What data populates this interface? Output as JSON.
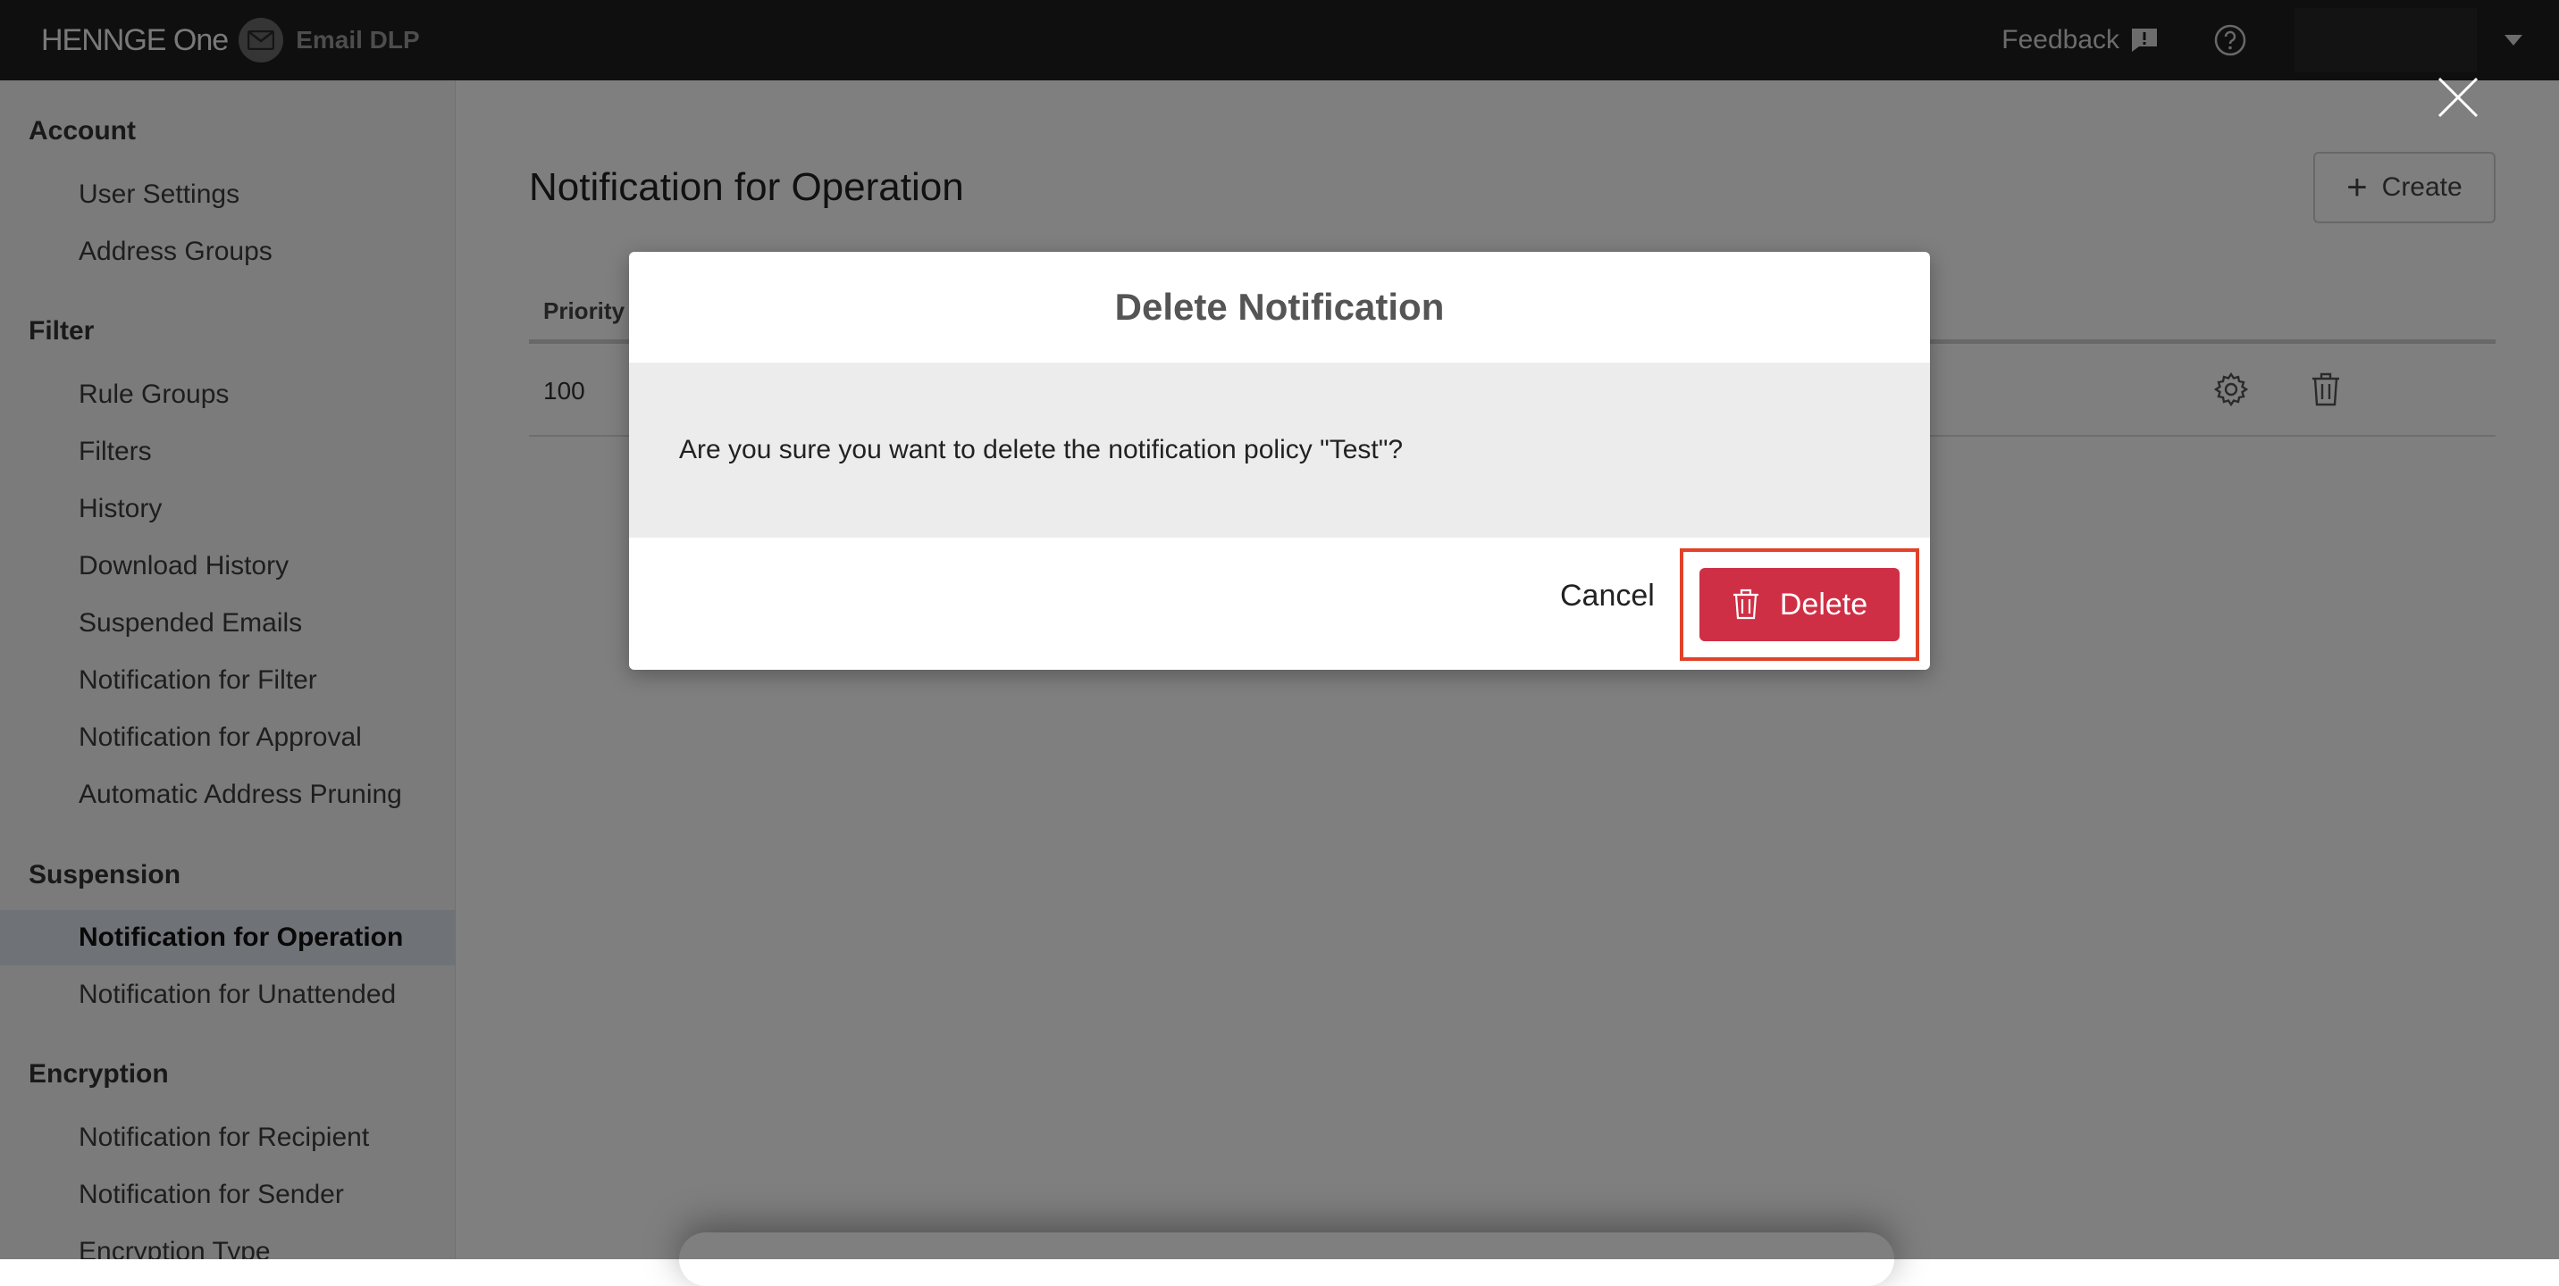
{
  "header": {
    "brand_name": "HENNGE One",
    "product_name": "Email DLP",
    "feedback_label": "Feedback"
  },
  "sidebar": {
    "sections": [
      {
        "title": "Account",
        "items": [
          "User Settings",
          "Address Groups"
        ]
      },
      {
        "title": "Filter",
        "items": [
          "Rule Groups",
          "Filters",
          "History",
          "Download History",
          "Suspended Emails",
          "Notification for Filter",
          "Notification for Approval",
          "Automatic Address Pruning"
        ]
      },
      {
        "title": "Suspension",
        "items": [
          "Notification for Operation",
          "Notification for Unattended"
        ]
      },
      {
        "title": "Encryption",
        "items": [
          "Notification for Recipient",
          "Notification for Sender",
          "Encryption Type"
        ]
      }
    ],
    "active_item": "Notification for Operation"
  },
  "main": {
    "page_title": "Notification for Operation",
    "create_label": "Create",
    "table": {
      "columns": [
        "Priority"
      ],
      "rows": [
        {
          "priority": "100"
        }
      ]
    }
  },
  "modal": {
    "title": "Delete Notification",
    "message": "Are you sure you want to delete the notification policy \"Test\"?",
    "cancel_label": "Cancel",
    "delete_label": "Delete"
  },
  "colors": {
    "topbar_bg": "#1e1e1e",
    "danger": "#cf2f45",
    "highlight": "#e0422a",
    "active_nav_bg": "#dfe6ef"
  },
  "icons": [
    "mail-icon",
    "feedback-icon",
    "help-icon",
    "caret-down-icon",
    "close-icon",
    "plus-icon",
    "gear-icon",
    "trash-icon"
  ]
}
